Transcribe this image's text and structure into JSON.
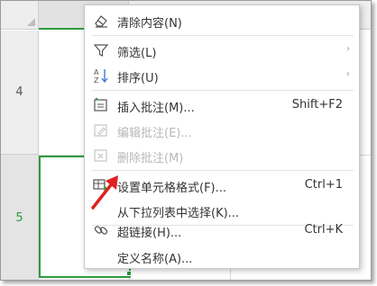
{
  "grid": {
    "row_labels": [
      "4",
      "5"
    ],
    "selected_cell_accent": "#2e9b3e"
  },
  "menu": {
    "items": [
      {
        "label": "清除内容(N)",
        "shortcut": "",
        "submenu": false,
        "disabled": false,
        "icon": "eraser-icon"
      },
      {
        "label": "筛选(L)",
        "shortcut": "",
        "submenu": true,
        "disabled": false,
        "icon": "filter-icon"
      },
      {
        "label": "排序(U)",
        "shortcut": "",
        "submenu": true,
        "disabled": false,
        "icon": "sort-az-icon"
      },
      {
        "label": "插入批注(M)...",
        "shortcut": "Shift+F2",
        "submenu": false,
        "disabled": false,
        "icon": "insert-comment-icon"
      },
      {
        "label": "编辑批注(E)...",
        "shortcut": "",
        "submenu": false,
        "disabled": true,
        "icon": "edit-comment-icon"
      },
      {
        "label": "删除批注(M)",
        "shortcut": "",
        "submenu": false,
        "disabled": true,
        "icon": "delete-comment-icon"
      },
      {
        "label": "设置单元格格式(F)...",
        "shortcut": "Ctrl+1",
        "submenu": false,
        "disabled": false,
        "icon": "format-cells-icon"
      },
      {
        "label": "从下拉列表中选择(K)...",
        "shortcut": "",
        "submenu": false,
        "disabled": false,
        "icon": ""
      },
      {
        "label": "超链接(H)...",
        "shortcut": "Ctrl+K",
        "submenu": false,
        "disabled": false,
        "icon": "link-icon"
      },
      {
        "label": "定义名称(A)...",
        "shortcut": "",
        "submenu": false,
        "disabled": false,
        "icon": ""
      }
    ]
  },
  "annotation": {
    "arrow_color": "#e02020"
  }
}
